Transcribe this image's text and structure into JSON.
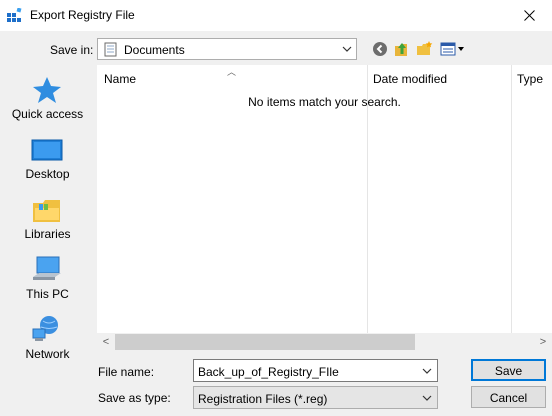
{
  "window": {
    "title": "Export Registry File",
    "close_label": "✕"
  },
  "save_in": {
    "label": "Save in:",
    "value": "Documents"
  },
  "toolbar": {
    "back_icon": "back-arrow-icon",
    "up_icon": "up-folder-icon",
    "new_folder_icon": "new-folder-icon",
    "view_menu_icon": "view-menu-icon"
  },
  "places": [
    {
      "label": "Quick access",
      "icon": "star-icon"
    },
    {
      "label": "Desktop",
      "icon": "desktop-icon"
    },
    {
      "label": "Libraries",
      "icon": "libraries-icon"
    },
    {
      "label": "This PC",
      "icon": "computer-icon"
    },
    {
      "label": "Network",
      "icon": "network-icon"
    }
  ],
  "file_list": {
    "columns": [
      "Name",
      "Date modified",
      "Type"
    ],
    "empty_message": "No items match your search."
  },
  "file_name": {
    "label": "File name:",
    "value": "Back_up_of_Registry_FIle"
  },
  "save_as_type": {
    "label": "Save as type:",
    "value": "Registration Files (*.reg)"
  },
  "buttons": {
    "save": "Save",
    "cancel": "Cancel"
  },
  "colors": {
    "accent": "#0078d7",
    "folder": "#f0c040"
  }
}
